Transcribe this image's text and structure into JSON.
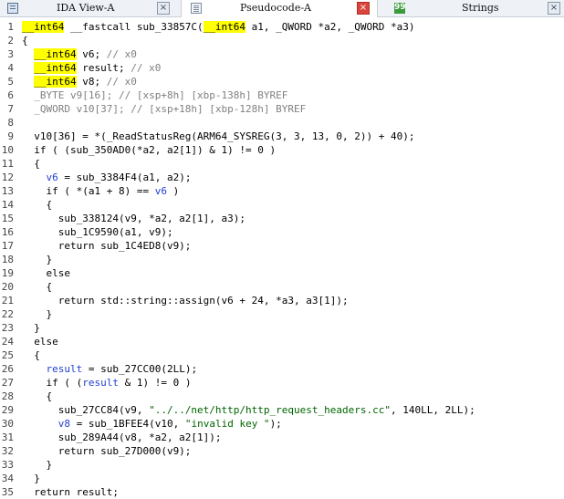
{
  "tabs": [
    {
      "label": "IDA View-A",
      "close": "×",
      "icon": "ida-view-icon"
    },
    {
      "label": "Pseudocode-A",
      "close": "×",
      "icon": "pseudocode-icon"
    },
    {
      "label": "Strings",
      "close": "×",
      "icon": "strings-icon",
      "glyph": "99"
    }
  ],
  "colors": {
    "highlight": "#ffff00",
    "comment": "#808080",
    "string": "#006400",
    "local_var": "#1f3fd0"
  },
  "lines": [
    {
      "n": "1",
      "segs": [
        {
          "t": "__int64",
          "c": "hl"
        },
        {
          "t": " __fastcall sub_33857C("
        },
        {
          "t": "__int64",
          "c": "hl"
        },
        {
          "t": " a1, _QWORD *a2, _QWORD *a3)"
        }
      ]
    },
    {
      "n": "2",
      "segs": [
        {
          "t": "{"
        }
      ]
    },
    {
      "n": "3",
      "segs": [
        {
          "t": "  "
        },
        {
          "t": "__int64",
          "c": "hl"
        },
        {
          "t": " v6; "
        },
        {
          "t": "// x0",
          "c": "cmt"
        }
      ]
    },
    {
      "n": "4",
      "segs": [
        {
          "t": "  "
        },
        {
          "t": "__int64",
          "c": "hl"
        },
        {
          "t": " result; "
        },
        {
          "t": "// x0",
          "c": "cmt"
        }
      ]
    },
    {
      "n": "5",
      "segs": [
        {
          "t": "  "
        },
        {
          "t": "__int64",
          "c": "hl"
        },
        {
          "t": " v8; "
        },
        {
          "t": "// x0",
          "c": "cmt"
        }
      ]
    },
    {
      "n": "6",
      "segs": [
        {
          "t": "  _BYTE v9[16]; // [xsp+8h] [xbp-138h] BYREF",
          "c": "cmt"
        }
      ]
    },
    {
      "n": "7",
      "segs": [
        {
          "t": "  _QWORD v10[37]; // [xsp+18h] [xbp-128h] BYREF",
          "c": "cmt"
        }
      ]
    },
    {
      "n": "8",
      "segs": [
        {
          "t": ""
        }
      ]
    },
    {
      "n": "9",
      "segs": [
        {
          "t": "  v10[36] = *(_ReadStatusReg(ARM64_SYSREG(3, 3, 13, 0, 2)) + 40);"
        }
      ]
    },
    {
      "n": "10",
      "segs": [
        {
          "t": "  if ( (sub_350AD0(*a2, a2[1]) & 1) != 0 )"
        }
      ]
    },
    {
      "n": "11",
      "segs": [
        {
          "t": "  {"
        }
      ]
    },
    {
      "n": "12",
      "segs": [
        {
          "t": "    "
        },
        {
          "t": "v6",
          "c": "lv"
        },
        {
          "t": " = sub_3384F4(a1, a2);"
        }
      ]
    },
    {
      "n": "13",
      "segs": [
        {
          "t": "    if ( *(a1 + 8) == "
        },
        {
          "t": "v6",
          "c": "lv"
        },
        {
          "t": " )"
        }
      ]
    },
    {
      "n": "14",
      "segs": [
        {
          "t": "    {"
        }
      ]
    },
    {
      "n": "15",
      "segs": [
        {
          "t": "      sub_338124(v9, *a2, a2[1], a3);"
        }
      ]
    },
    {
      "n": "16",
      "segs": [
        {
          "t": "      sub_1C9590(a1, v9);"
        }
      ]
    },
    {
      "n": "17",
      "segs": [
        {
          "t": "      return sub_1C4ED8(v9);"
        }
      ]
    },
    {
      "n": "18",
      "segs": [
        {
          "t": "    }"
        }
      ]
    },
    {
      "n": "19",
      "segs": [
        {
          "t": "    else"
        }
      ]
    },
    {
      "n": "20",
      "segs": [
        {
          "t": "    {"
        }
      ]
    },
    {
      "n": "21",
      "segs": [
        {
          "t": "      return std::string::assign(v6 + 24, *a3, a3[1]);"
        }
      ]
    },
    {
      "n": "22",
      "segs": [
        {
          "t": "    }"
        }
      ]
    },
    {
      "n": "23",
      "segs": [
        {
          "t": "  }"
        }
      ]
    },
    {
      "n": "24",
      "segs": [
        {
          "t": "  else"
        }
      ]
    },
    {
      "n": "25",
      "segs": [
        {
          "t": "  {"
        }
      ]
    },
    {
      "n": "26",
      "segs": [
        {
          "t": "    "
        },
        {
          "t": "result",
          "c": "lv"
        },
        {
          "t": " = sub_27CC00(2LL);"
        }
      ]
    },
    {
      "n": "27",
      "segs": [
        {
          "t": "    if ( ("
        },
        {
          "t": "result",
          "c": "lv"
        },
        {
          "t": " & 1) != 0 )"
        }
      ]
    },
    {
      "n": "28",
      "segs": [
        {
          "t": "    {"
        }
      ]
    },
    {
      "n": "29",
      "segs": [
        {
          "t": "      sub_27CC84(v9, "
        },
        {
          "t": "\"../../net/http/http_request_headers.cc\"",
          "c": "str"
        },
        {
          "t": ", 140LL, 2LL);"
        }
      ]
    },
    {
      "n": "30",
      "segs": [
        {
          "t": "      "
        },
        {
          "t": "v8",
          "c": "lv"
        },
        {
          "t": " = sub_1BFEE4(v10, "
        },
        {
          "t": "\"invalid key \"",
          "c": "str"
        },
        {
          "t": ");"
        }
      ]
    },
    {
      "n": "31",
      "segs": [
        {
          "t": "      sub_289A44(v8, *a2, a2[1]);"
        }
      ]
    },
    {
      "n": "32",
      "segs": [
        {
          "t": "      return sub_27D000(v9);"
        }
      ]
    },
    {
      "n": "33",
      "segs": [
        {
          "t": "    }"
        }
      ]
    },
    {
      "n": "34",
      "segs": [
        {
          "t": "  }"
        }
      ]
    },
    {
      "n": "35",
      "segs": [
        {
          "t": "  return result;"
        }
      ]
    }
  ]
}
